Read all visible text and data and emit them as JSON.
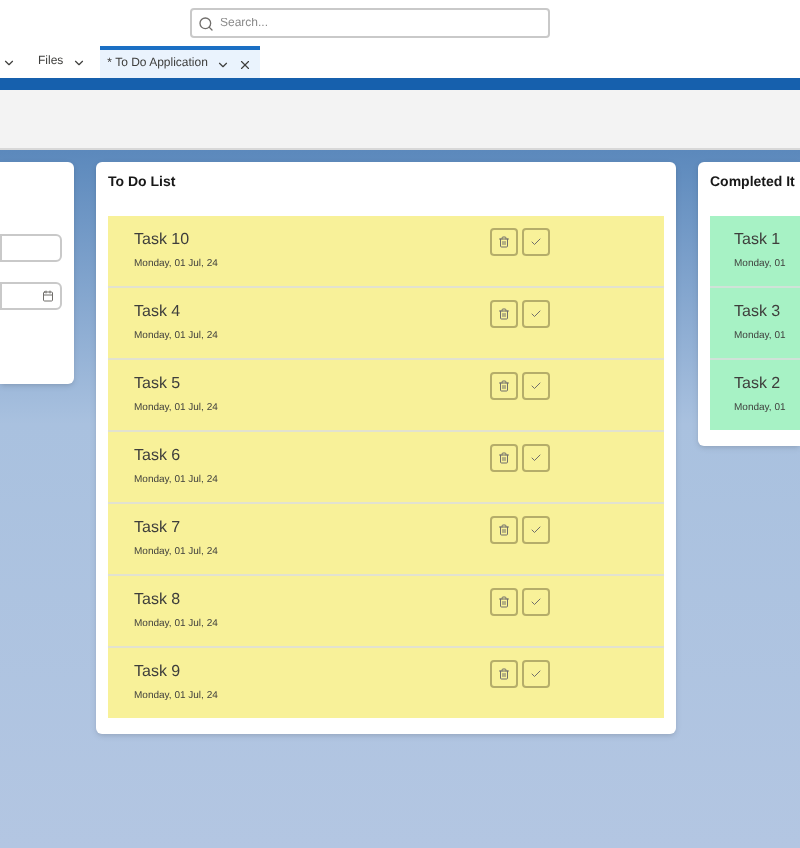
{
  "search": {
    "placeholder": "Search..."
  },
  "tabs": [
    {
      "label": "Files",
      "selected": false,
      "closable": false
    },
    {
      "label": "* To Do Application",
      "selected": true,
      "closable": true
    }
  ],
  "todo": {
    "title": "To Do List",
    "tasks": [
      {
        "name": "Task 10",
        "date": "Monday, 01 Jul, 24"
      },
      {
        "name": "Task 4",
        "date": "Monday, 01 Jul, 24"
      },
      {
        "name": "Task 5",
        "date": "Monday, 01 Jul, 24"
      },
      {
        "name": "Task 6",
        "date": "Monday, 01 Jul, 24"
      },
      {
        "name": "Task 7",
        "date": "Monday, 01 Jul, 24"
      },
      {
        "name": "Task 8",
        "date": "Monday, 01 Jul, 24"
      },
      {
        "name": "Task 9",
        "date": "Monday, 01 Jul, 24"
      }
    ]
  },
  "completed": {
    "title": "Completed It",
    "tasks": [
      {
        "name": "Task 1",
        "date": "Monday, 01"
      },
      {
        "name": "Task 3",
        "date": "Monday, 01"
      },
      {
        "name": "Task 2",
        "date": "Monday, 01"
      }
    ]
  }
}
